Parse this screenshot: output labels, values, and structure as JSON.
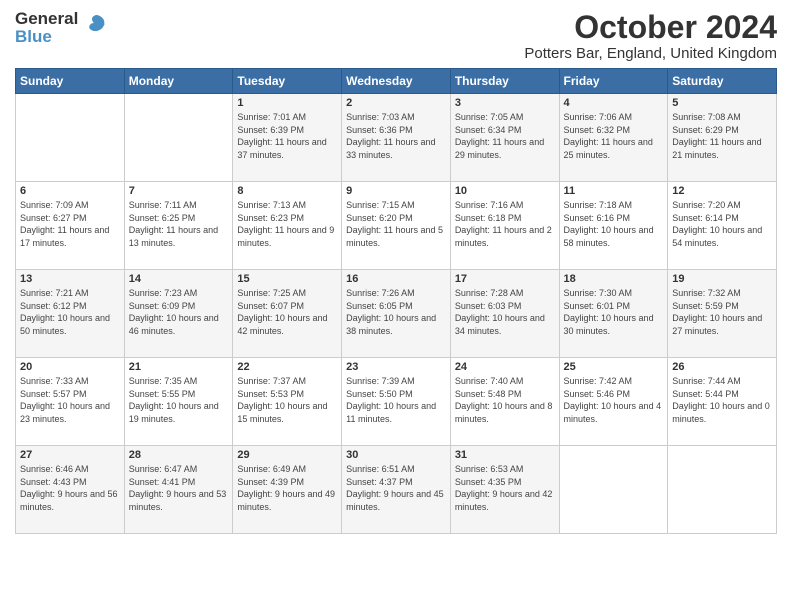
{
  "header": {
    "logo_line1": "General",
    "logo_line2": "Blue",
    "title": "October 2024",
    "subtitle": "Potters Bar, England, United Kingdom"
  },
  "columns": [
    "Sunday",
    "Monday",
    "Tuesday",
    "Wednesday",
    "Thursday",
    "Friday",
    "Saturday"
  ],
  "weeks": [
    [
      {
        "day": "",
        "sunrise": "",
        "sunset": "",
        "daylight": ""
      },
      {
        "day": "",
        "sunrise": "",
        "sunset": "",
        "daylight": ""
      },
      {
        "day": "1",
        "sunrise": "Sunrise: 7:01 AM",
        "sunset": "Sunset: 6:39 PM",
        "daylight": "Daylight: 11 hours and 37 minutes."
      },
      {
        "day": "2",
        "sunrise": "Sunrise: 7:03 AM",
        "sunset": "Sunset: 6:36 PM",
        "daylight": "Daylight: 11 hours and 33 minutes."
      },
      {
        "day": "3",
        "sunrise": "Sunrise: 7:05 AM",
        "sunset": "Sunset: 6:34 PM",
        "daylight": "Daylight: 11 hours and 29 minutes."
      },
      {
        "day": "4",
        "sunrise": "Sunrise: 7:06 AM",
        "sunset": "Sunset: 6:32 PM",
        "daylight": "Daylight: 11 hours and 25 minutes."
      },
      {
        "day": "5",
        "sunrise": "Sunrise: 7:08 AM",
        "sunset": "Sunset: 6:29 PM",
        "daylight": "Daylight: 11 hours and 21 minutes."
      }
    ],
    [
      {
        "day": "6",
        "sunrise": "Sunrise: 7:09 AM",
        "sunset": "Sunset: 6:27 PM",
        "daylight": "Daylight: 11 hours and 17 minutes."
      },
      {
        "day": "7",
        "sunrise": "Sunrise: 7:11 AM",
        "sunset": "Sunset: 6:25 PM",
        "daylight": "Daylight: 11 hours and 13 minutes."
      },
      {
        "day": "8",
        "sunrise": "Sunrise: 7:13 AM",
        "sunset": "Sunset: 6:23 PM",
        "daylight": "Daylight: 11 hours and 9 minutes."
      },
      {
        "day": "9",
        "sunrise": "Sunrise: 7:15 AM",
        "sunset": "Sunset: 6:20 PM",
        "daylight": "Daylight: 11 hours and 5 minutes."
      },
      {
        "day": "10",
        "sunrise": "Sunrise: 7:16 AM",
        "sunset": "Sunset: 6:18 PM",
        "daylight": "Daylight: 11 hours and 2 minutes."
      },
      {
        "day": "11",
        "sunrise": "Sunrise: 7:18 AM",
        "sunset": "Sunset: 6:16 PM",
        "daylight": "Daylight: 10 hours and 58 minutes."
      },
      {
        "day": "12",
        "sunrise": "Sunrise: 7:20 AM",
        "sunset": "Sunset: 6:14 PM",
        "daylight": "Daylight: 10 hours and 54 minutes."
      }
    ],
    [
      {
        "day": "13",
        "sunrise": "Sunrise: 7:21 AM",
        "sunset": "Sunset: 6:12 PM",
        "daylight": "Daylight: 10 hours and 50 minutes."
      },
      {
        "day": "14",
        "sunrise": "Sunrise: 7:23 AM",
        "sunset": "Sunset: 6:09 PM",
        "daylight": "Daylight: 10 hours and 46 minutes."
      },
      {
        "day": "15",
        "sunrise": "Sunrise: 7:25 AM",
        "sunset": "Sunset: 6:07 PM",
        "daylight": "Daylight: 10 hours and 42 minutes."
      },
      {
        "day": "16",
        "sunrise": "Sunrise: 7:26 AM",
        "sunset": "Sunset: 6:05 PM",
        "daylight": "Daylight: 10 hours and 38 minutes."
      },
      {
        "day": "17",
        "sunrise": "Sunrise: 7:28 AM",
        "sunset": "Sunset: 6:03 PM",
        "daylight": "Daylight: 10 hours and 34 minutes."
      },
      {
        "day": "18",
        "sunrise": "Sunrise: 7:30 AM",
        "sunset": "Sunset: 6:01 PM",
        "daylight": "Daylight: 10 hours and 30 minutes."
      },
      {
        "day": "19",
        "sunrise": "Sunrise: 7:32 AM",
        "sunset": "Sunset: 5:59 PM",
        "daylight": "Daylight: 10 hours and 27 minutes."
      }
    ],
    [
      {
        "day": "20",
        "sunrise": "Sunrise: 7:33 AM",
        "sunset": "Sunset: 5:57 PM",
        "daylight": "Daylight: 10 hours and 23 minutes."
      },
      {
        "day": "21",
        "sunrise": "Sunrise: 7:35 AM",
        "sunset": "Sunset: 5:55 PM",
        "daylight": "Daylight: 10 hours and 19 minutes."
      },
      {
        "day": "22",
        "sunrise": "Sunrise: 7:37 AM",
        "sunset": "Sunset: 5:53 PM",
        "daylight": "Daylight: 10 hours and 15 minutes."
      },
      {
        "day": "23",
        "sunrise": "Sunrise: 7:39 AM",
        "sunset": "Sunset: 5:50 PM",
        "daylight": "Daylight: 10 hours and 11 minutes."
      },
      {
        "day": "24",
        "sunrise": "Sunrise: 7:40 AM",
        "sunset": "Sunset: 5:48 PM",
        "daylight": "Daylight: 10 hours and 8 minutes."
      },
      {
        "day": "25",
        "sunrise": "Sunrise: 7:42 AM",
        "sunset": "Sunset: 5:46 PM",
        "daylight": "Daylight: 10 hours and 4 minutes."
      },
      {
        "day": "26",
        "sunrise": "Sunrise: 7:44 AM",
        "sunset": "Sunset: 5:44 PM",
        "daylight": "Daylight: 10 hours and 0 minutes."
      }
    ],
    [
      {
        "day": "27",
        "sunrise": "Sunrise: 6:46 AM",
        "sunset": "Sunset: 4:43 PM",
        "daylight": "Daylight: 9 hours and 56 minutes."
      },
      {
        "day": "28",
        "sunrise": "Sunrise: 6:47 AM",
        "sunset": "Sunset: 4:41 PM",
        "daylight": "Daylight: 9 hours and 53 minutes."
      },
      {
        "day": "29",
        "sunrise": "Sunrise: 6:49 AM",
        "sunset": "Sunset: 4:39 PM",
        "daylight": "Daylight: 9 hours and 49 minutes."
      },
      {
        "day": "30",
        "sunrise": "Sunrise: 6:51 AM",
        "sunset": "Sunset: 4:37 PM",
        "daylight": "Daylight: 9 hours and 45 minutes."
      },
      {
        "day": "31",
        "sunrise": "Sunrise: 6:53 AM",
        "sunset": "Sunset: 4:35 PM",
        "daylight": "Daylight: 9 hours and 42 minutes."
      },
      {
        "day": "",
        "sunrise": "",
        "sunset": "",
        "daylight": ""
      },
      {
        "day": "",
        "sunrise": "",
        "sunset": "",
        "daylight": ""
      }
    ]
  ]
}
